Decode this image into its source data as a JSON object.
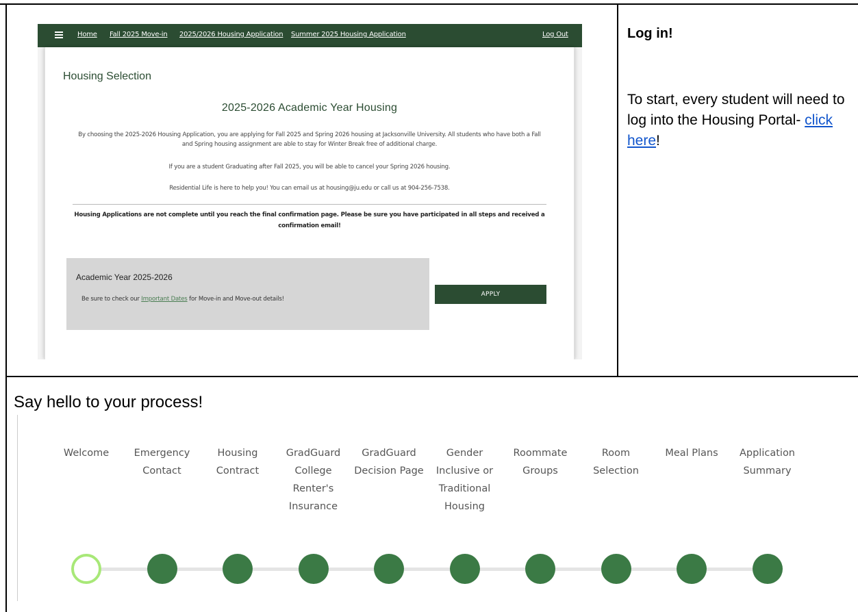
{
  "portal": {
    "nav": {
      "items": [
        "Home",
        "Fall 2025 Move-in",
        "2025/2026 Housing Application",
        "Summer 2025 Housing Application"
      ],
      "logout": "Log Out"
    },
    "page_title": "Housing Selection",
    "section_title": "2025-2026 Academic Year Housing",
    "paragraphs": [
      "By choosing the 2025-2026 Housing Application, you are applying for Fall 2025 and Spring 2026 housing at Jacksonville University. All students who have both a Fall and Spring housing assignment are able to stay for Winter Break free of additional charge.",
      "If you are a student Graduating after Fall 2025, you will be able to cancel your Spring 2026 housing.",
      "Residential Life is here to help you! You can email us at housing@ju.edu or call us at 904-256-7538."
    ],
    "notice": "Housing Applications are not complete until you reach the final confirmation page. Please be sure you have participated in all steps and received a confirmation email!",
    "card": {
      "title": "Academic Year 2025-2026",
      "text_before": "Be sure to check our ",
      "link": "Important Dates",
      "text_after": " for Move-in and Move-out details!"
    },
    "apply_label": "APPLY"
  },
  "login": {
    "title": "Log in!",
    "text": "To start, every student will need to log into the Housing Portal- ",
    "link": "click here",
    "suffix": "!"
  },
  "process": {
    "title": "Say hello to your process!",
    "steps": [
      {
        "label": "Welcome",
        "status": "current"
      },
      {
        "label": "Emergency Contact",
        "status": "upcoming"
      },
      {
        "label": "Housing Contract",
        "status": "upcoming"
      },
      {
        "label": "GradGuard College Renter's Insurance",
        "status": "upcoming"
      },
      {
        "label": "GradGuard Decision Page",
        "status": "upcoming"
      },
      {
        "label": "Gender Inclusive or Traditional Housing",
        "status": "upcoming"
      },
      {
        "label": "Roommate Groups",
        "status": "upcoming"
      },
      {
        "label": "Room Selection",
        "status": "upcoming"
      },
      {
        "label": "Meal Plans",
        "status": "upcoming"
      },
      {
        "label": "Application Summary",
        "status": "upcoming"
      }
    ]
  },
  "colors": {
    "brand_green": "#2b4c32",
    "step_done": "#3b7a45",
    "step_current": "#a8e878",
    "link_blue": "#1155cc"
  }
}
